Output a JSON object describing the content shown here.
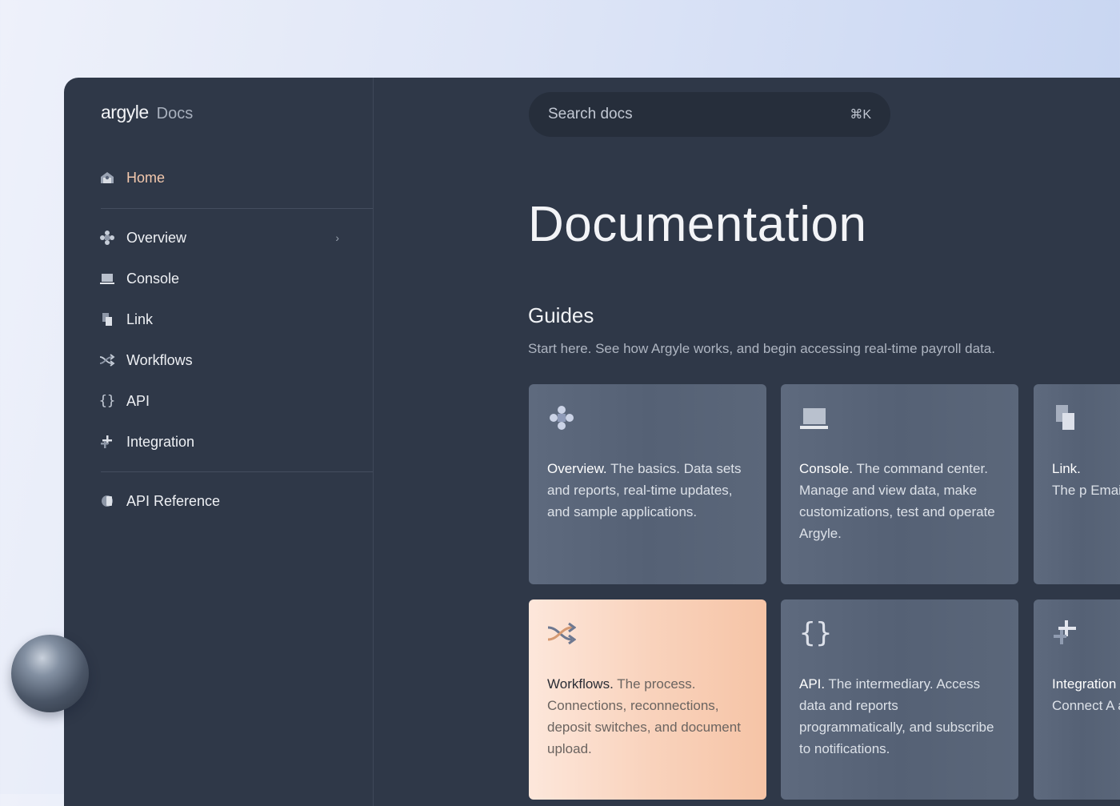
{
  "brand": {
    "logo": "argyle",
    "section": "Docs"
  },
  "sidebar": {
    "items": [
      {
        "label": "Home",
        "icon": "home-icon"
      },
      {
        "label": "Overview",
        "icon": "overview-icon"
      },
      {
        "label": "Console",
        "icon": "laptop-icon"
      },
      {
        "label": "Link",
        "icon": "link-pages-icon"
      },
      {
        "label": "Workflows",
        "icon": "shuffle-icon"
      },
      {
        "label": "API",
        "icon": "braces-icon"
      },
      {
        "label": "Integration",
        "icon": "plus-cross-icon"
      },
      {
        "label": "API Reference",
        "icon": "api-reference-icon"
      }
    ]
  },
  "search": {
    "placeholder": "Search docs",
    "shortcut": "⌘K"
  },
  "main": {
    "title": "Documentation",
    "guides_heading": "Guides",
    "guides_lead": "Start here. See how Argyle works, and begin accessing real-time payroll data."
  },
  "cards": [
    {
      "title": "Overview.",
      "body": "The basics. Data sets and reports, real-time updates, and sample applications."
    },
    {
      "title": "Console.",
      "body": "The command center. Manage and view data, make customizations, test and operate Argyle."
    },
    {
      "title": "Link.",
      "body": "The p Email, text for an emp login crede"
    },
    {
      "title": "Workflows.",
      "body": "The process. Connections, reconnections, deposit switches, and document upload."
    },
    {
      "title": "API.",
      "body": "The intermediary. Access data and reports programmatically, and subscribe to notifications."
    },
    {
      "title": "Integration",
      "body": "Connect A application business s"
    }
  ],
  "colors": {
    "accent_active": "#f3c8ad",
    "panel": "#2f3848",
    "warm_card": "#f9d3bd"
  }
}
